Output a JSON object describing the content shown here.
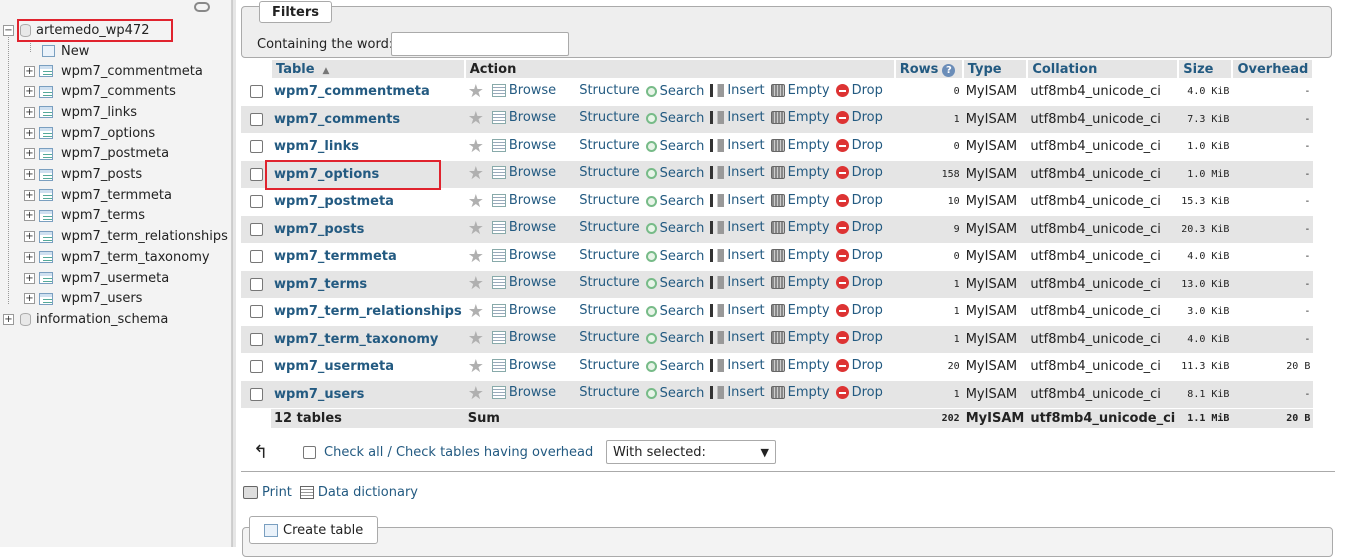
{
  "nav": {
    "db_name": "artemedo_wp472",
    "new_label": "New",
    "tables": [
      "wpm7_commentmeta",
      "wpm7_comments",
      "wpm7_links",
      "wpm7_options",
      "wpm7_postmeta",
      "wpm7_posts",
      "wpm7_termmeta",
      "wpm7_terms",
      "wpm7_term_relationships",
      "wpm7_term_taxonomy",
      "wpm7_usermeta",
      "wpm7_users"
    ],
    "other_db": "information_schema"
  },
  "filters": {
    "legend": "Filters",
    "label": "Containing the word:",
    "value": ""
  },
  "table": {
    "headers": {
      "table": "Table",
      "action": "Action",
      "rows": "Rows",
      "type": "Type",
      "collation": "Collation",
      "size": "Size",
      "overhead": "Overhead"
    },
    "actions": {
      "browse": "Browse",
      "structure": "Structure",
      "search": "Search",
      "insert": "Insert",
      "empty": "Empty",
      "drop": "Drop"
    },
    "rows": [
      {
        "name": "wpm7_commentmeta",
        "rows": "0",
        "type": "MyISAM",
        "collation": "utf8mb4_unicode_ci",
        "size": "4.0 KiB",
        "overhead": "-"
      },
      {
        "name": "wpm7_comments",
        "rows": "1",
        "type": "MyISAM",
        "collation": "utf8mb4_unicode_ci",
        "size": "7.3 KiB",
        "overhead": "-"
      },
      {
        "name": "wpm7_links",
        "rows": "0",
        "type": "MyISAM",
        "collation": "utf8mb4_unicode_ci",
        "size": "1.0 KiB",
        "overhead": "-"
      },
      {
        "name": "wpm7_options",
        "rows": "158",
        "type": "MyISAM",
        "collation": "utf8mb4_unicode_ci",
        "size": "1.0 MiB",
        "overhead": "-"
      },
      {
        "name": "wpm7_postmeta",
        "rows": "10",
        "type": "MyISAM",
        "collation": "utf8mb4_unicode_ci",
        "size": "15.3 KiB",
        "overhead": "-"
      },
      {
        "name": "wpm7_posts",
        "rows": "9",
        "type": "MyISAM",
        "collation": "utf8mb4_unicode_ci",
        "size": "20.3 KiB",
        "overhead": "-"
      },
      {
        "name": "wpm7_termmeta",
        "rows": "0",
        "type": "MyISAM",
        "collation": "utf8mb4_unicode_ci",
        "size": "4.0 KiB",
        "overhead": "-"
      },
      {
        "name": "wpm7_terms",
        "rows": "1",
        "type": "MyISAM",
        "collation": "utf8mb4_unicode_ci",
        "size": "13.0 KiB",
        "overhead": "-"
      },
      {
        "name": "wpm7_term_relationships",
        "rows": "1",
        "type": "MyISAM",
        "collation": "utf8mb4_unicode_ci",
        "size": "3.0 KiB",
        "overhead": "-"
      },
      {
        "name": "wpm7_term_taxonomy",
        "rows": "1",
        "type": "MyISAM",
        "collation": "utf8mb4_unicode_ci",
        "size": "4.0 KiB",
        "overhead": "-"
      },
      {
        "name": "wpm7_usermeta",
        "rows": "20",
        "type": "MyISAM",
        "collation": "utf8mb4_unicode_ci",
        "size": "11.3 KiB",
        "overhead": "20 B"
      },
      {
        "name": "wpm7_users",
        "rows": "1",
        "type": "MyISAM",
        "collation": "utf8mb4_unicode_ci",
        "size": "8.1 KiB",
        "overhead": "-"
      }
    ],
    "summary": {
      "count": "12 tables",
      "label": "Sum",
      "rows": "202",
      "type": "MyISAM",
      "collation": "utf8mb4_unicode_ci",
      "size": "1.1 MiB",
      "overhead": "20 B"
    }
  },
  "bulk": {
    "check_all": "Check all / Check tables having overhead",
    "with_selected": "With selected:"
  },
  "footer": {
    "print": "Print",
    "data_dictionary": "Data dictionary",
    "create_table": "Create table"
  },
  "colors": {
    "link": "#235a81",
    "highlight": "#e0232e",
    "row_alt": "#e5e5e5"
  }
}
